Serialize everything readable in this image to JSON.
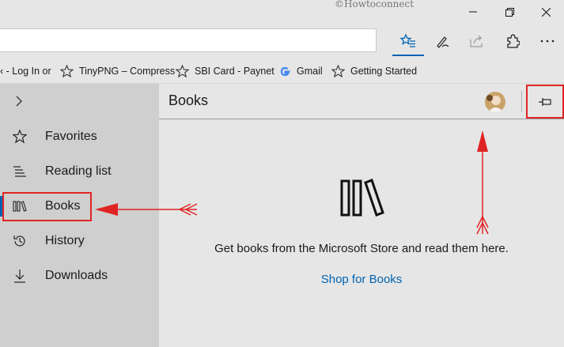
{
  "window": {
    "watermark": "©Howtoconnect",
    "minimize_icon": "minimize-icon",
    "maximize_icon": "restore-icon",
    "close_icon": "close-icon"
  },
  "toolbar": {
    "address_value": "",
    "buttons": [
      {
        "name": "hub-favorites-icon",
        "active": true
      },
      {
        "name": "web-note-icon"
      },
      {
        "name": "share-icon"
      },
      {
        "name": "extensions-icon"
      },
      {
        "name": "more-icon"
      }
    ]
  },
  "favorites_bar": [
    {
      "label": "‹ - Log In or",
      "icon": "none"
    },
    {
      "label": "TinyPNG – Compress",
      "icon": "star-icon"
    },
    {
      "label": "SBI Card - Paynet",
      "icon": "star-icon"
    },
    {
      "label": "Gmail",
      "icon": "google-icon"
    },
    {
      "label": "Getting Started",
      "icon": "star-icon"
    }
  ],
  "hub": {
    "expand_icon": "chevron-right-icon",
    "nav": [
      {
        "label": "Favorites",
        "icon": "star-icon"
      },
      {
        "label": "Reading list",
        "icon": "reading-list-icon"
      },
      {
        "label": "Books",
        "icon": "books-icon",
        "selected": true
      },
      {
        "label": "History",
        "icon": "history-icon"
      },
      {
        "label": "Downloads",
        "icon": "download-icon"
      }
    ],
    "pane_title": "Books",
    "empty_message": "Get books from the Microsoft Store and read them here.",
    "shop_link": "Shop for Books",
    "pin_icon": "pin-icon"
  },
  "colors": {
    "accent": "#0063b1",
    "annotation": "#e02424",
    "nav_bg": "#cfcfcf",
    "content_bg": "#e6e6e6"
  }
}
